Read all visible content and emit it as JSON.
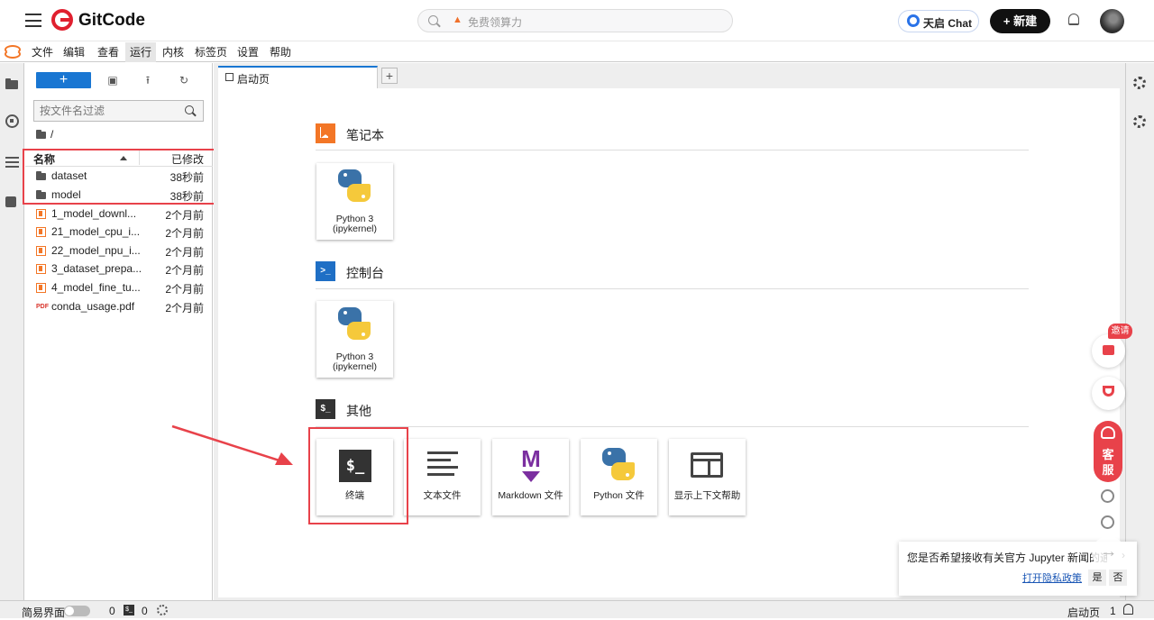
{
  "header": {
    "brand": "GitCode",
    "search_placeholder": "免费领算力",
    "chat_label": "天启 Chat",
    "new_label": "+ 新建"
  },
  "menu": {
    "items": [
      "文件",
      "编辑",
      "查看",
      "运行",
      "内核",
      "标签页",
      "设置",
      "帮助"
    ],
    "active": "运行"
  },
  "filebrowser": {
    "new_label": "+",
    "filter_placeholder": "按文件名过滤",
    "path": "/",
    "col_name": "名称",
    "col_modified": "已修改",
    "files": [
      {
        "name": "dataset",
        "modified": "38秒前",
        "type": "folder"
      },
      {
        "name": "model",
        "modified": "38秒前",
        "type": "folder"
      },
      {
        "name": "1_model_downl...",
        "modified": "2个月前",
        "type": "notebook"
      },
      {
        "name": "21_model_cpu_i...",
        "modified": "2个月前",
        "type": "notebook"
      },
      {
        "name": "22_model_npu_i...",
        "modified": "2个月前",
        "type": "notebook"
      },
      {
        "name": "3_dataset_prepa...",
        "modified": "2个月前",
        "type": "notebook"
      },
      {
        "name": "4_model_fine_tu...",
        "modified": "2个月前",
        "type": "notebook"
      },
      {
        "name": "conda_usage.pdf",
        "modified": "2个月前",
        "type": "pdf"
      }
    ]
  },
  "tab": {
    "label": "启动页",
    "add_label": "+"
  },
  "launcher": {
    "notebook_section": "笔记本",
    "console_section": "控制台",
    "other_section": "其他",
    "console_icon_text": ">_",
    "other_icon_text": "$_",
    "notebook_card": {
      "line1": "Python 3",
      "line2": "(ipykernel)"
    },
    "console_card": {
      "line1": "Python 3",
      "line2": "(ipykernel)"
    },
    "other_cards": [
      {
        "label": "终端",
        "icon": "terminal-icon",
        "glyph": "$_"
      },
      {
        "label": "文本文件",
        "icon": "text-file-icon"
      },
      {
        "label": "Markdown 文件",
        "icon": "markdown-icon",
        "glyph": "M"
      },
      {
        "label": "Python 文件",
        "icon": "python-icon"
      },
      {
        "label": "显示上下文帮助",
        "icon": "context-help-icon"
      }
    ]
  },
  "floating": {
    "invite_label": "邀请",
    "service_label_1": "客",
    "service_label_2": "服"
  },
  "notification": {
    "message": "您是否希望接收有关官方 Jupyter 新闻的通知",
    "close_label": "›",
    "privacy_link": "打开隐私政策",
    "yes_label": "是",
    "no_label": "否"
  },
  "statusbar": {
    "simple_mode_label": "简易界面",
    "kernel_count": "0",
    "terminal_count": "0",
    "terminal_glyph": "$_",
    "current_tab": "启动页",
    "notification_count": "1"
  },
  "colors": {
    "accent_blue": "#1976d2",
    "jupyter_orange": "#f37626",
    "highlight_red": "#e8424a"
  }
}
